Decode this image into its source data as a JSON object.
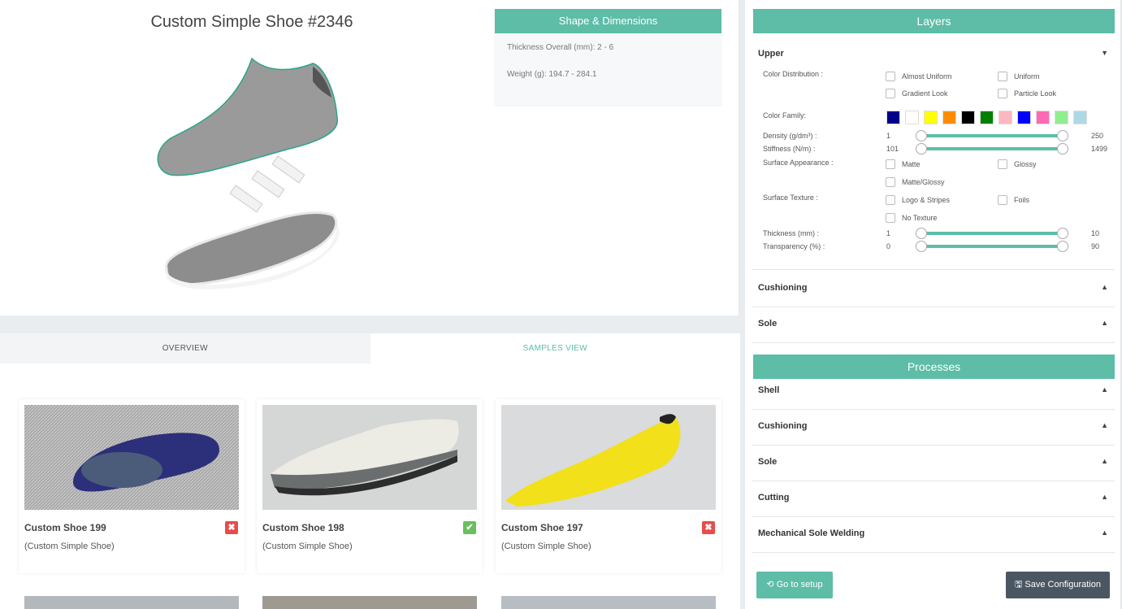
{
  "preview": {
    "title": "Custom Simple Shoe #2346"
  },
  "shape_card": {
    "title": "Shape & Dimensions",
    "thickness": "Thickness Overall (mm): 2 - 6",
    "weight": "Weight (g): 194.7 - 284.1"
  },
  "tabs": {
    "overview": "OVERVIEW",
    "samples": "SAMPLES VIEW"
  },
  "samples": [
    {
      "name": "Custom Shoe 199",
      "type": "(Custom Simple Shoe)",
      "status": "rejected",
      "status_icon": "✖",
      "color": "#2c2f7a"
    },
    {
      "name": "Custom Shoe 198",
      "type": "(Custom Simple Shoe)",
      "status": "approved",
      "status_icon": "✔",
      "color": "#d8d8d0"
    },
    {
      "name": "Custom Shoe 197",
      "type": "(Custom Simple Shoe)",
      "status": "rejected",
      "status_icon": "✖",
      "color": "#f2e01a"
    }
  ],
  "layers": {
    "title": "Layers",
    "upper": {
      "label": "Upper",
      "caret": "▼",
      "color_distribution_label": "Color Distribution :",
      "color_distribution_options": [
        "Almost Uniform",
        "Uniform",
        "Gradient Look",
        "Particle Look"
      ],
      "color_family_label": "Color Family:",
      "color_family": [
        "#00008b",
        "#ffffff",
        "#ffff00",
        "#ff8c00",
        "#000000",
        "#008000",
        "#ffb6c1",
        "#0000ff",
        "#ff69b4",
        "#90ee90",
        "#add8e6"
      ],
      "density_label": "Density (g/dm³) :",
      "density_min": "1",
      "density_max": "250",
      "stiffness_label": "Stiffness (N/m) :",
      "stiffness_min": "101",
      "stiffness_max": "1499",
      "surface_appearance_label": "Surface Appearance :",
      "surface_appearance_options": [
        "Matte",
        "Glossy",
        "Matte/Glossy"
      ],
      "surface_texture_label": "Surface Texture :",
      "surface_texture_options": [
        "Logo & Stripes",
        "Foils",
        "No Texture"
      ],
      "thickness_label": "Thickness (mm) :",
      "thickness_min": "1",
      "thickness_max": "10",
      "transparency_label": "Transparency (%) :",
      "transparency_min": "0",
      "transparency_max": "90"
    },
    "cushioning": "Cushioning",
    "sole": "Sole",
    "caret_up": "▲"
  },
  "processes": {
    "title": "Processes",
    "items": [
      "Shell",
      "Cushioning",
      "Sole",
      "Cutting",
      "Mechanical Sole Welding"
    ],
    "caret_up": "▲"
  },
  "actions": {
    "setup": "⟲ Go to setup",
    "save": "🖫 Save Configuration"
  },
  "colors": {
    "accent": "#5dbda7",
    "dark_button": "#4a5763"
  }
}
